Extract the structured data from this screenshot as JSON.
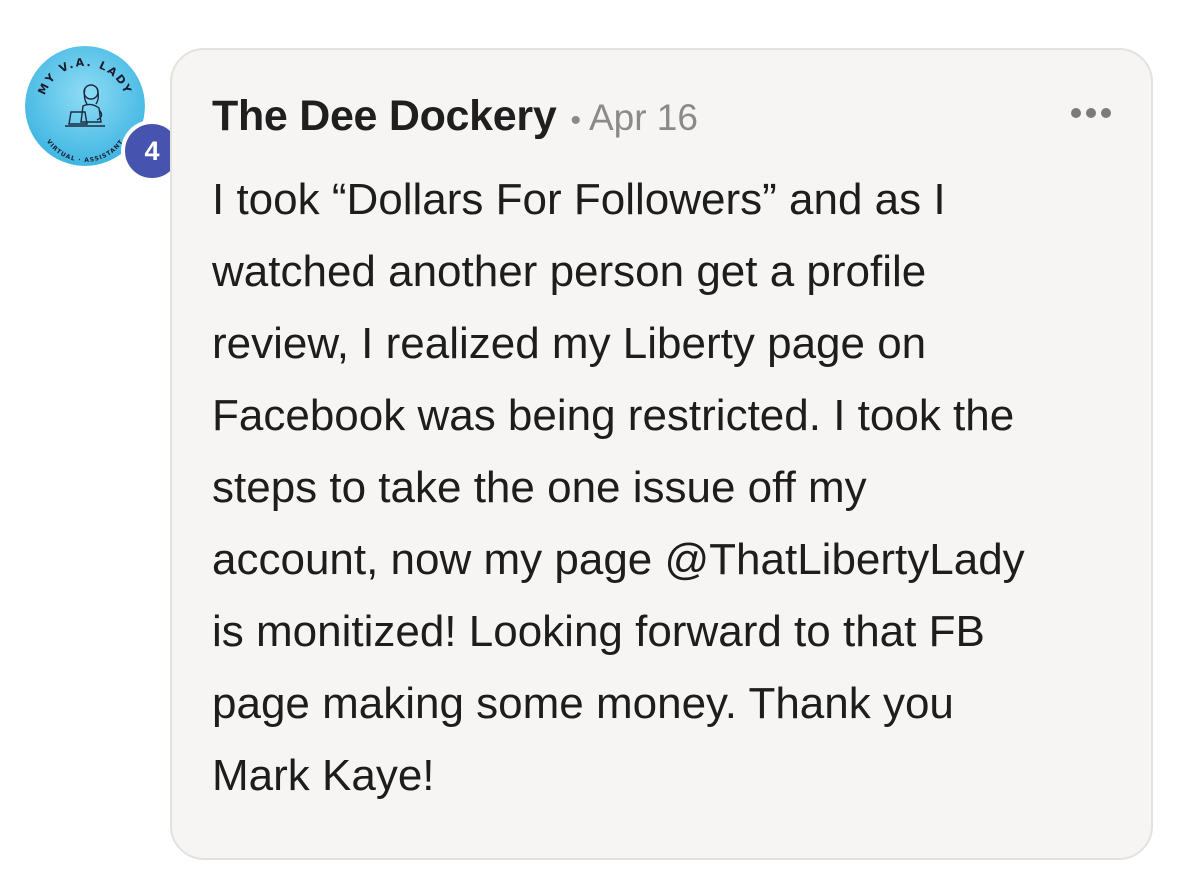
{
  "avatar": {
    "logo_text_top": "MY V.A. LADY",
    "logo_text_bottom": "VIRTUAL · ASSISTANT",
    "level": "4",
    "bg_color": "#5ec3e8"
  },
  "post": {
    "author": "The Dee Dockery",
    "separator": "•",
    "date": "Apr 16",
    "menu_icon": "more-horizontal-icon",
    "body_lines": [
      "I took “Dollars For Followers” and as I",
      "watched another person get a profile",
      "review, I realized my Liberty page on",
      "Facebook was being restricted. I took the",
      "steps to take the one issue off my",
      "account, now my page @ThatLibertyLady",
      "is monitized! Looking forward to that FB",
      "page making some money. Thank you",
      "Mark Kaye!"
    ]
  },
  "colors": {
    "badge": "#4654b0",
    "card_bg": "#f6f5f3",
    "muted_text": "#8a8a8a"
  }
}
